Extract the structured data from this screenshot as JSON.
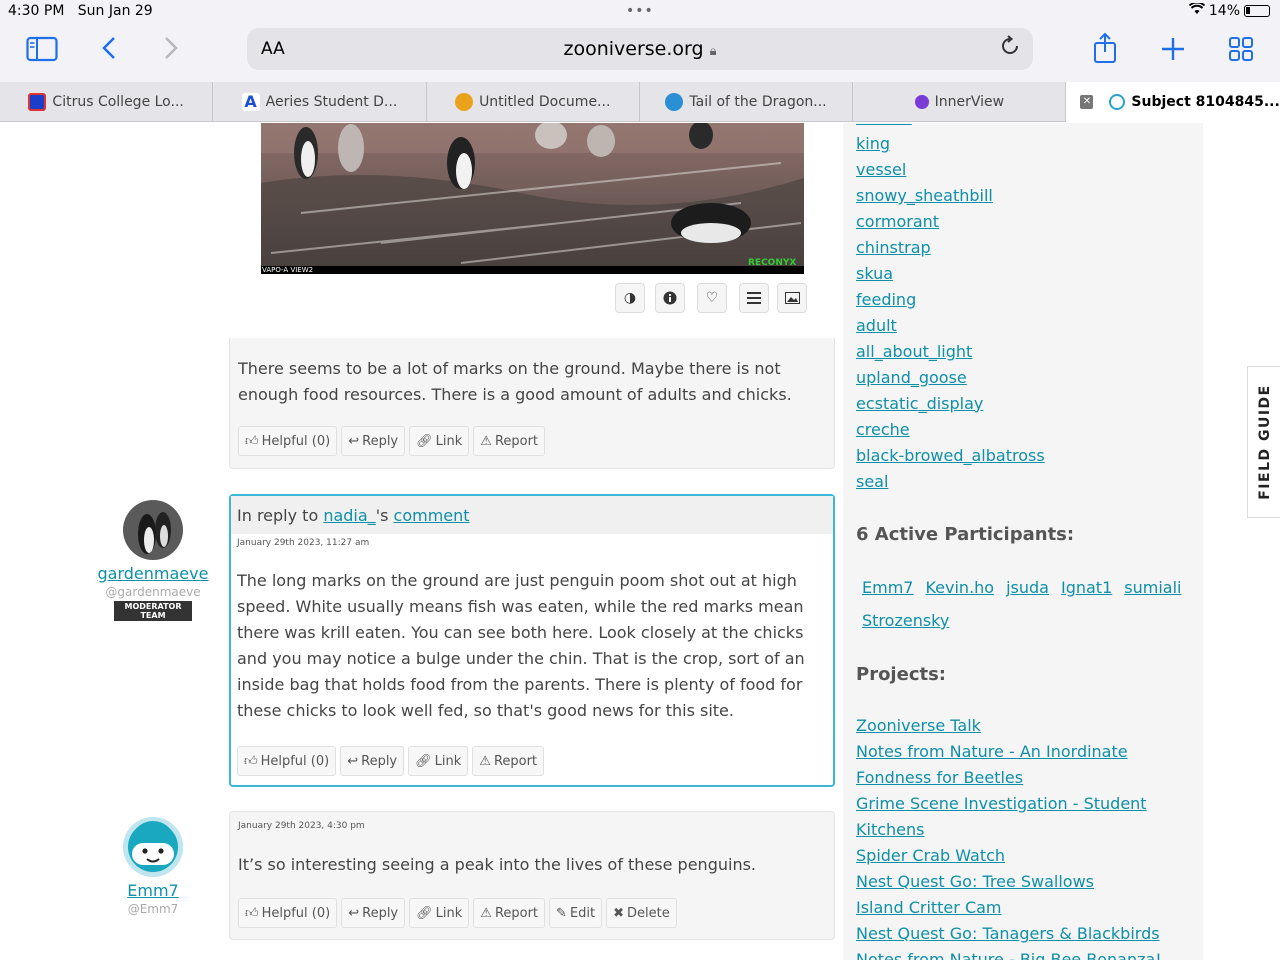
{
  "status": {
    "time": "4:30 PM",
    "date": "Sun Jan 29",
    "battery": "14%"
  },
  "browser": {
    "text_size_label": "AA",
    "url": "zooniverse.org",
    "tabs": [
      {
        "label": "Citrus College Lo...",
        "color": "#d33"
      },
      {
        "label": "Aeries Student D...",
        "color": "#1a4fd6"
      },
      {
        "label": "Untitled Docume...",
        "color": "#e8a21b"
      },
      {
        "label": "Tail of the Dragon...",
        "color": "#2b8fd6"
      },
      {
        "label": "InnerView",
        "color": "#7a3bd6"
      },
      {
        "label": "Subject 8104845...",
        "color": "#2aa3c9"
      }
    ]
  },
  "image": {
    "camera_label": "VAPO-A VIEW2",
    "brand": "RECONYX"
  },
  "comments": [
    {
      "text": "There seems to be a lot of marks on the ground. Maybe there is not enough food resources. There is a good amount of adults and chicks.",
      "actions": [
        "Helpful (0)",
        "Reply",
        "Link",
        "Report"
      ]
    },
    {
      "author": "gardenmaeve",
      "handle": "@gardenmaeve",
      "badge_line1": "MODERATOR",
      "badge_line2": "TEAM",
      "reply_prefix": "In reply to",
      "reply_user": "nadia_",
      "reply_mid": "'s",
      "reply_link": "comment",
      "date": "January 29th 2023, 11:27 am",
      "text": "The long marks on the ground are just penguin poom shot out at high speed. White usually means fish was eaten, while the red marks mean there was krill eaten. You can see both here. Look closely at the chicks and you may notice a bulge under the chin. That is the crop, sort of an inside bag that holds food from the parents. There is plenty of food for these chicks to look well fed, so that's good news for this site.",
      "actions": [
        "Helpful (0)",
        "Reply",
        "Link",
        "Report"
      ]
    },
    {
      "author": "Emm7",
      "handle": "@Emm7",
      "date": "January 29th 2023, 4:30 pm",
      "text": "It’s so interesting seeing a peak into the lives of these penguins.",
      "actions": [
        "Helpful (0)",
        "Reply",
        "Link",
        "Report",
        "Edit",
        "Delete"
      ]
    }
  ],
  "sidebar": {
    "tags": [
      "human",
      "king",
      "vessel",
      "snowy_sheathbill",
      "cormorant",
      "chinstrap",
      "skua",
      "feeding",
      "adult",
      "all_about_light",
      "upland_goose",
      "ecstatic_display",
      "creche",
      "black-browed_albatross",
      "seal"
    ],
    "participants_heading": "6 Active Participants:",
    "participants": [
      "Emm7",
      "Kevin.ho",
      "jsuda",
      "Ignat1",
      "sumiali",
      "Strozensky"
    ],
    "projects_heading": "Projects:",
    "projects": [
      "Zooniverse Talk",
      "Notes from Nature - An Inordinate",
      "Fondness for Beetles",
      "Grime Scene Investigation - Student",
      "Kitchens",
      "Spider Crab Watch",
      "Nest Quest Go: Tree Swallows",
      "Island Critter Cam",
      "Nest Quest Go: Tanagers & Blackbirds",
      "Notes from Nature - Big Bee Bonanza!"
    ],
    "field_guide": "FIELD GUIDE"
  }
}
